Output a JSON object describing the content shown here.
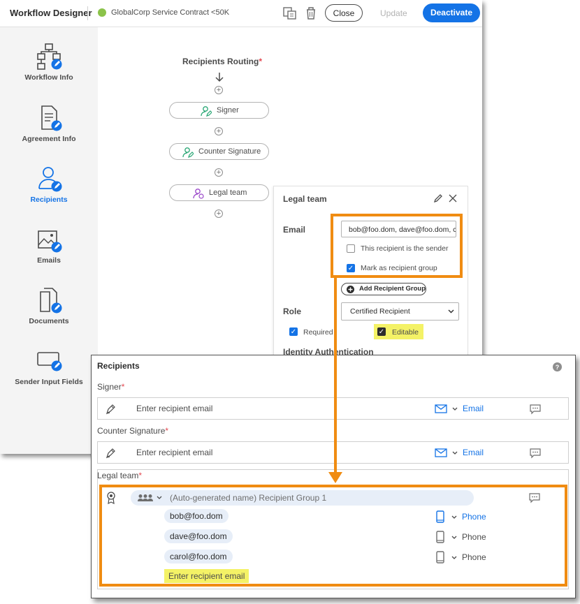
{
  "topbar": {
    "app_title": "Workflow Designer",
    "workflow_name": "GlobalCorp Service Contract <50K",
    "close_label": "Close",
    "update_label": "Update",
    "deactivate_label": "Deactivate"
  },
  "sidebar": {
    "items": [
      {
        "label": "Workflow Info",
        "icon": "workflow-icon"
      },
      {
        "label": "Agreement Info",
        "icon": "agreement-icon"
      },
      {
        "label": "Recipients",
        "icon": "recipients-icon",
        "active": true
      },
      {
        "label": "Emails",
        "icon": "emails-icon"
      },
      {
        "label": "Documents",
        "icon": "documents-icon"
      },
      {
        "label": "Sender Input Fields",
        "icon": "sender-input-icon"
      }
    ]
  },
  "routing": {
    "title": "Recipients Routing",
    "required_mark": "*",
    "steps": [
      {
        "label": "Signer",
        "icon": "signer-icon"
      },
      {
        "label": "Counter Signature",
        "icon": "signer-icon"
      },
      {
        "label": "Legal team",
        "icon": "approver-icon"
      }
    ]
  },
  "panel": {
    "title": "Legal team",
    "email_label": "Email",
    "email_value": "bob@foo.dom, dave@foo.dom, carol@foo.dom",
    "sender_checkbox": {
      "label": "This recipient is the sender",
      "checked": false
    },
    "group_checkbox": {
      "label": "Mark as recipient group",
      "checked": true
    },
    "add_group_button": "Add Recipient Group",
    "role_label": "Role",
    "role_value": "Certified Recipient",
    "required_checkbox": {
      "label": "Required",
      "checked": true
    },
    "editable_checkbox": {
      "label": "Editable",
      "checked": true
    },
    "identity_label": "Identity Authentication"
  },
  "recipients": {
    "title": "Recipients",
    "signer": {
      "label": "Signer",
      "placeholder": "Enter recipient email",
      "method": "Email"
    },
    "counter": {
      "label": "Counter Signature",
      "placeholder": "Enter recipient email",
      "method": "Email"
    },
    "legal": {
      "label": "Legal team",
      "group_name": "(Auto-generated name) Recipient Group 1",
      "members": [
        {
          "email": "bob@foo.dom",
          "method": "Phone"
        },
        {
          "email": "dave@foo.dom",
          "method": "Phone"
        },
        {
          "email": "carol@foo.dom",
          "method": "Phone"
        }
      ],
      "add_placeholder": "Enter recipient email"
    }
  },
  "colors": {
    "accent": "#1473e6",
    "highlight": "#f08c12",
    "yellow": "#f4f266"
  }
}
